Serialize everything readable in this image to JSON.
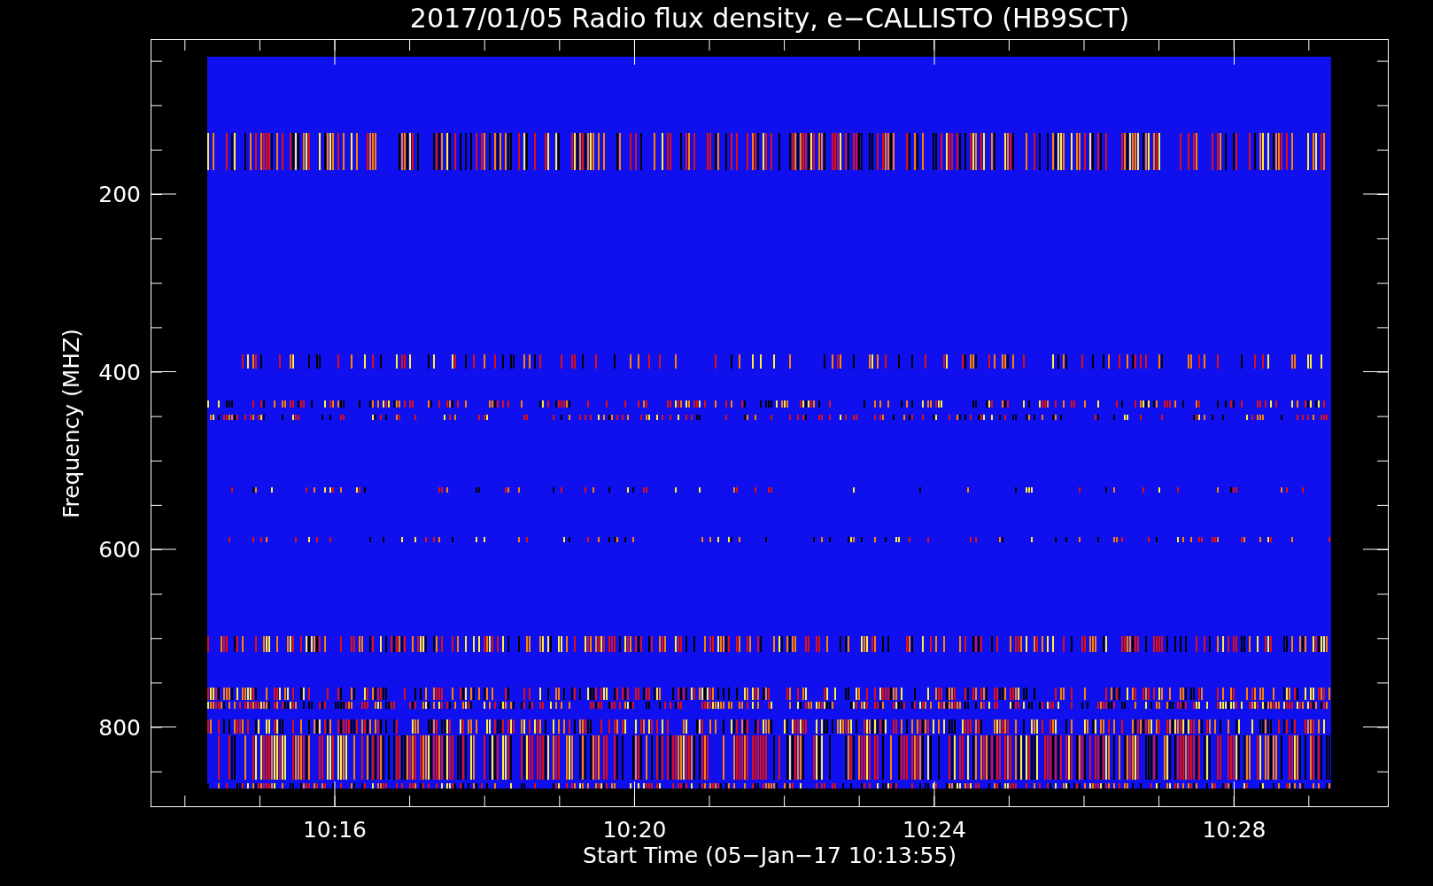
{
  "title": "2017/01/05  Radio flux density, e−CALLISTO (HB9SCT)",
  "y_axis": {
    "label": "Frequency (MHZ)",
    "ticks": [
      "200",
      "400",
      "600",
      "800"
    ]
  },
  "x_axis": {
    "label": "Start Time (05−Jan−17 10:13:55)",
    "ticks": [
      "10:16",
      "10:20",
      "10:24",
      "10:28"
    ]
  }
}
